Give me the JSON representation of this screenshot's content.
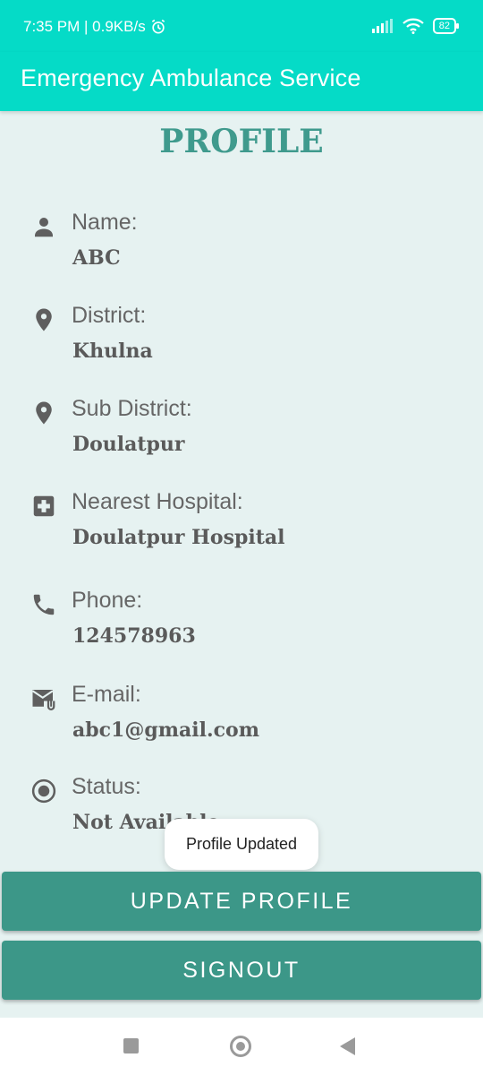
{
  "status_bar": {
    "time_speed": "7:35 PM | 0.9KB/s",
    "battery": "82"
  },
  "app_bar": {
    "title": "Emergency Ambulance Service"
  },
  "page": {
    "title": "PROFILE"
  },
  "fields": [
    {
      "label": "Name:",
      "value": "ABC",
      "icon": "person-icon"
    },
    {
      "label": "District:",
      "value": "Khulna",
      "icon": "location-pin-icon"
    },
    {
      "label": "Sub District:",
      "value": "Doulatpur",
      "icon": "location-pin-icon"
    },
    {
      "label": "Nearest Hospital:",
      "value": "Doulatpur Hospital",
      "icon": "hospital-icon"
    },
    {
      "label": "Phone:",
      "value": "124578963",
      "icon": "phone-icon"
    },
    {
      "label": "E-mail:",
      "value": "abc1@gmail.com",
      "icon": "email-icon"
    },
    {
      "label": "Status:",
      "value": "Not Available",
      "icon": "radio-status-icon"
    }
  ],
  "buttons": {
    "update": "UPDATE PROFILE",
    "signout": "SIGNOUT"
  },
  "toast": {
    "text": "Profile Updated"
  },
  "colors": {
    "accent": "#05dbc7",
    "button": "#3c9788",
    "title": "#3f9a8d",
    "background": "#e6f2f1"
  }
}
